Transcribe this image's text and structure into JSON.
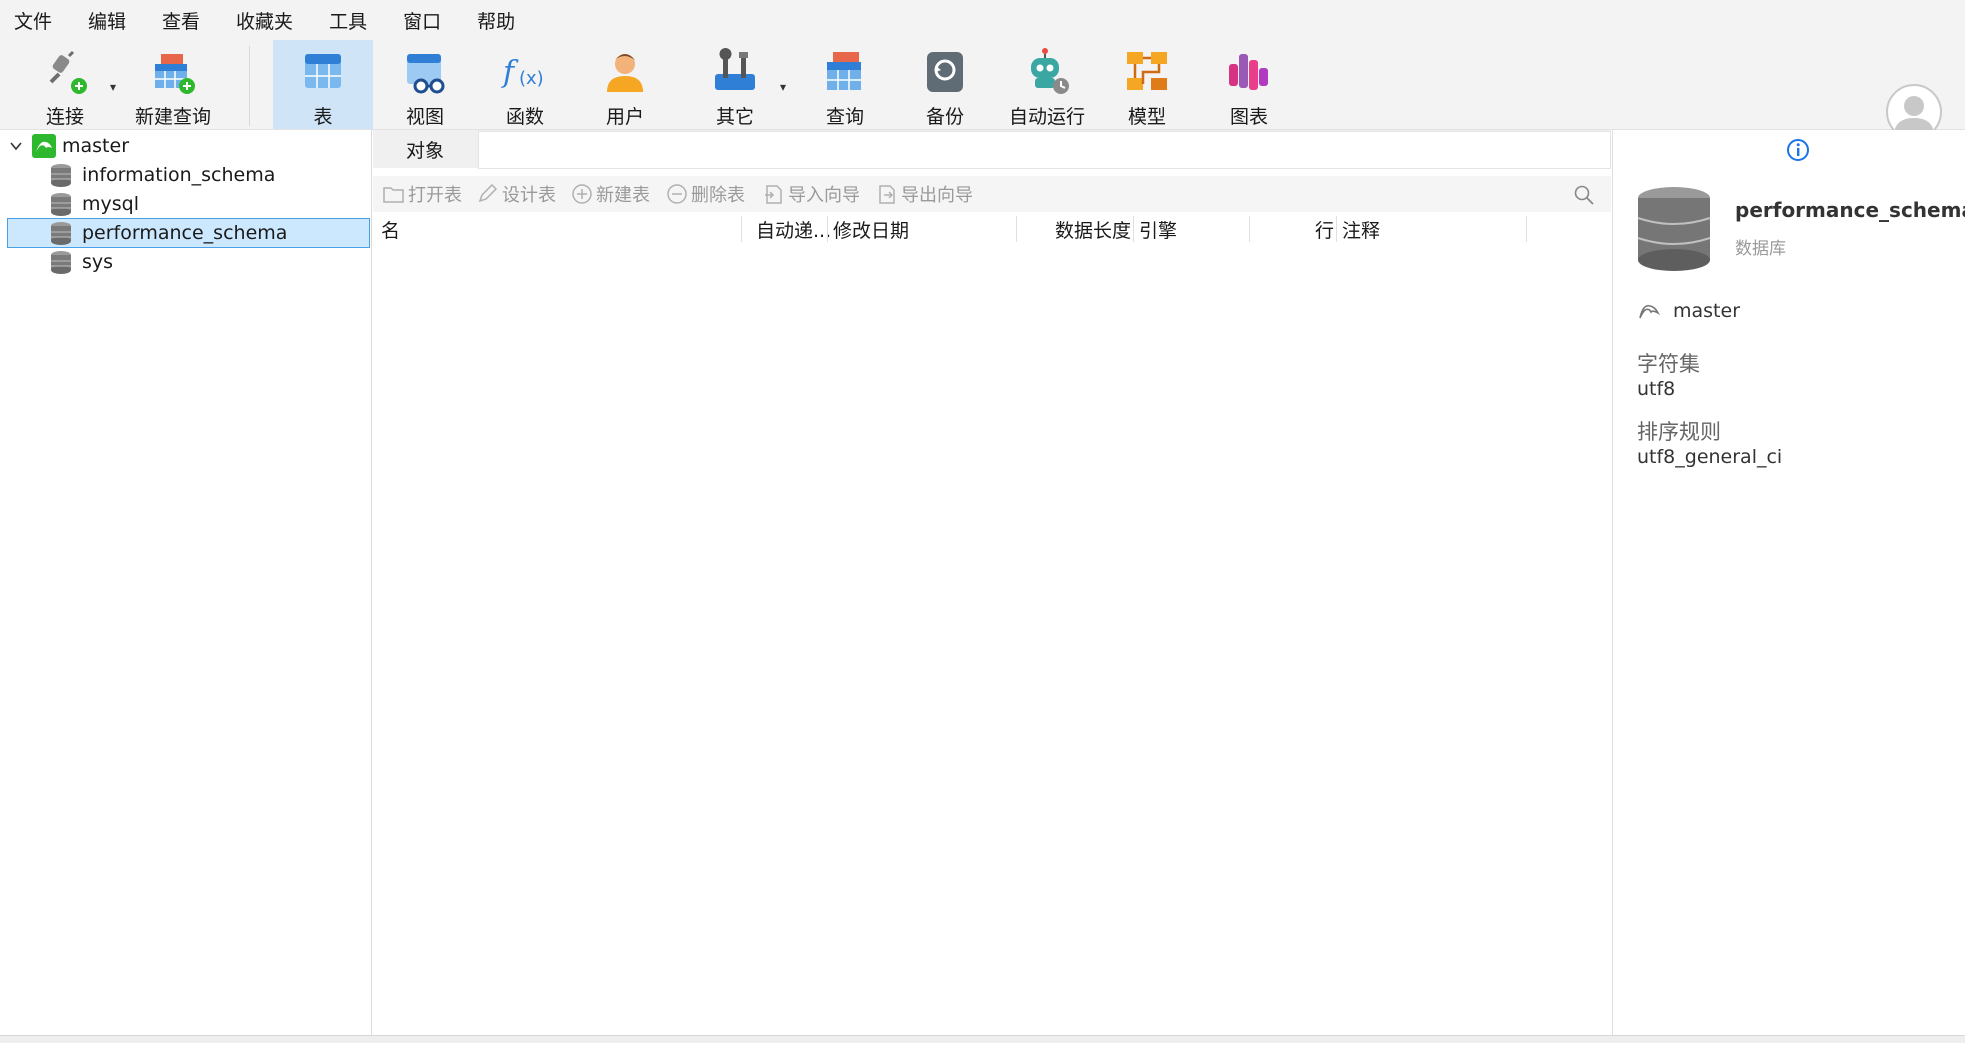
{
  "menu": [
    "文件",
    "编辑",
    "查看",
    "收藏夹",
    "工具",
    "窗口",
    "帮助"
  ],
  "toolbar": {
    "connect": "连接",
    "new_query": "新建查询",
    "table": "表",
    "view": "视图",
    "function": "函数",
    "user": "用户",
    "other": "其它",
    "query": "查询",
    "backup": "备份",
    "automation": "自动运行",
    "model": "模型",
    "chart": "图表"
  },
  "tree": {
    "connection": "master",
    "databases": [
      "information_schema",
      "mysql",
      "performance_schema",
      "sys"
    ],
    "selected": "performance_schema"
  },
  "main": {
    "tab_label": "对象",
    "actions": [
      "打开表",
      "设计表",
      "新建表",
      "删除表",
      "导入向导",
      "导出向导"
    ],
    "columns": [
      "名",
      "自动递...",
      "修改日期",
      "数据长度",
      "引擎",
      "行",
      "注释"
    ]
  },
  "info": {
    "name": "performance_schema",
    "type": "数据库",
    "connection": "master",
    "charset_label": "字符集",
    "charset": "utf8",
    "collation_label": "排序规则",
    "collation": "utf8_general_ci"
  },
  "colors": {
    "toolbar_bg": "#f3f3f3",
    "active_tool": "#cfe4f7",
    "selection": "#cce8ff",
    "selection_border": "#4aa0e6",
    "disabled_text": "#9a9a9a",
    "info_accent": "#1a73e8"
  }
}
